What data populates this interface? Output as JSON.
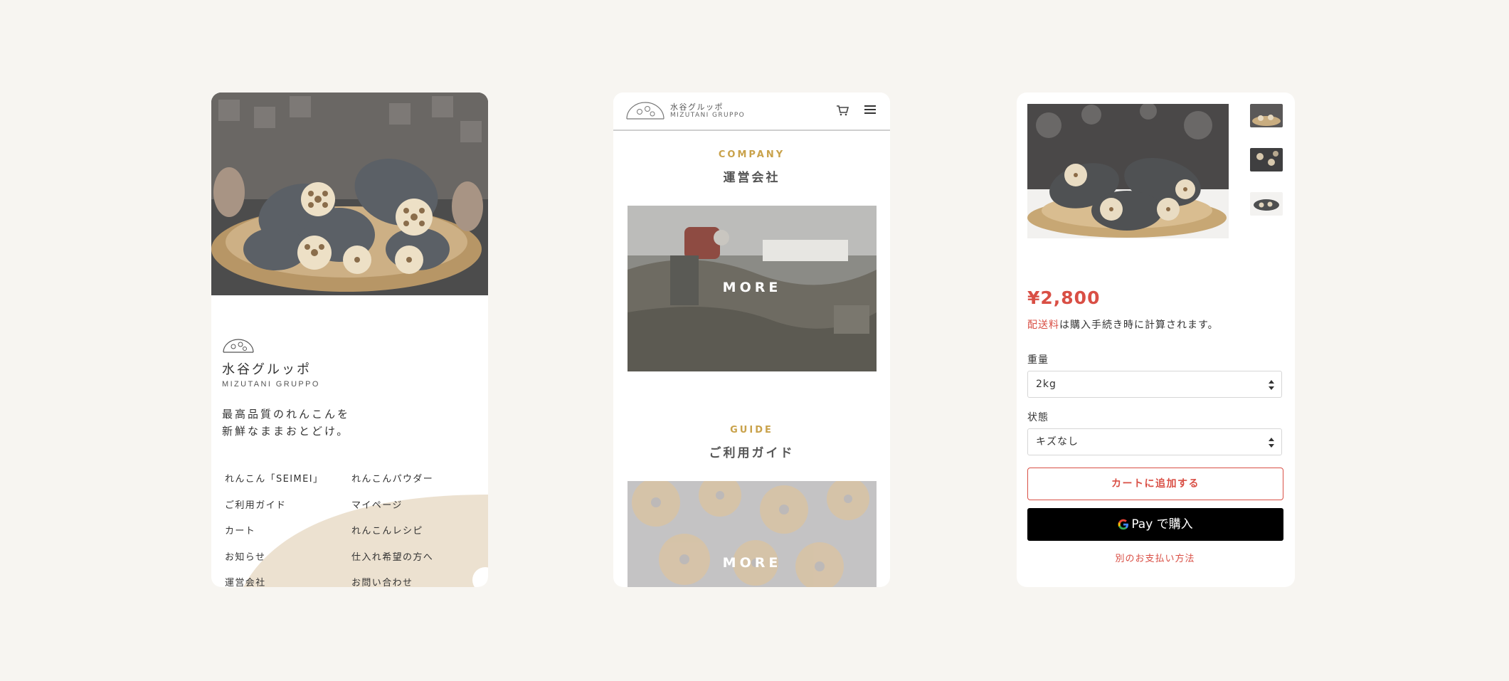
{
  "phone1": {
    "brand_jp": "水谷グルッポ",
    "brand_en": "MIZUTANI GRUPPO",
    "tagline_line1": "最高品質のれんこんを",
    "tagline_line2": "新鮮なままおとどけ。",
    "nav_items": [
      "れんこん「SEIMEI」",
      "れんこんパウダー",
      "ご利用ガイド",
      "マイページ",
      "カート",
      "れんこんレシピ",
      "お知らせ",
      "仕入れ希望の方へ",
      "運営会社",
      "お問い合わせ"
    ],
    "logo_icon": "lotus-logo-icon"
  },
  "phone2": {
    "header_brand_jp": "水谷グルッポ",
    "header_brand_en": "MIZUTANI GRUPPO",
    "cart_icon": "cart-icon",
    "menu_icon": "hamburger-menu-icon",
    "company_en": "COMPANY",
    "company_jp": "運営会社",
    "company_more": "MORE",
    "guide_en": "GUIDE",
    "guide_jp": "ご利用ガイド",
    "guide_more": "MORE"
  },
  "phone3": {
    "price": "¥2,800",
    "shipping_link": "配送料",
    "shipping_rest": "は購入手続き時に計算されます。",
    "weight_label": "重量",
    "weight_value": "2kg",
    "condition_label": "状態",
    "condition_value": "キズなし",
    "add_to_cart": "カートに追加する",
    "gpay_label": "Pay で購入",
    "other_payment": "別のお支払い方法"
  },
  "colors": {
    "accent_red": "#d94f45",
    "gold": "#c9a24b",
    "background": "#f7f5f1",
    "beige": "#ece1d0"
  }
}
